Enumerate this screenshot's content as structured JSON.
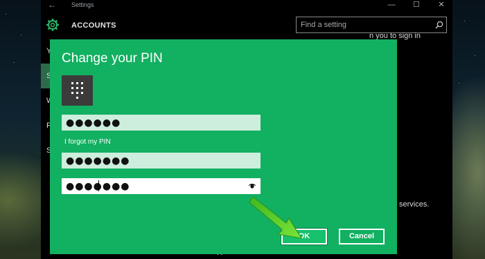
{
  "window": {
    "title": "Settings",
    "back_glyph": "←",
    "minimize_glyph": "—",
    "maximize_glyph": "☐",
    "close_glyph": "✕"
  },
  "header": {
    "heading": "ACCOUNTS",
    "icon": "gear-icon"
  },
  "search": {
    "placeholder": "Find a setting",
    "icon": "search-icon"
  },
  "sidebar": {
    "items": [
      {
        "label": "Y"
      },
      {
        "label": "S",
        "active": true
      },
      {
        "label": "W"
      },
      {
        "label": "F"
      },
      {
        "label": "S"
      }
    ]
  },
  "background_text": {
    "top_fragment": "n you to sign in",
    "services_fragment": "services.",
    "bottom_fragment": "R"
  },
  "dialog": {
    "title": "Change your PIN",
    "icon": "pin-keypad-icon",
    "old_pin_value": "●●●●●●",
    "forgot_link": "I forgot my PIN",
    "new_pin_value": "●●●●●●●",
    "confirm_pin_value": "●●●●●●●",
    "reveal_icon": "eye-icon",
    "ok_label": "OK",
    "cancel_label": "Cancel"
  },
  "colors": {
    "dialog_bg": "#12b061",
    "active_nav": "#2c6b4a",
    "arrow": "#4fd02a"
  }
}
